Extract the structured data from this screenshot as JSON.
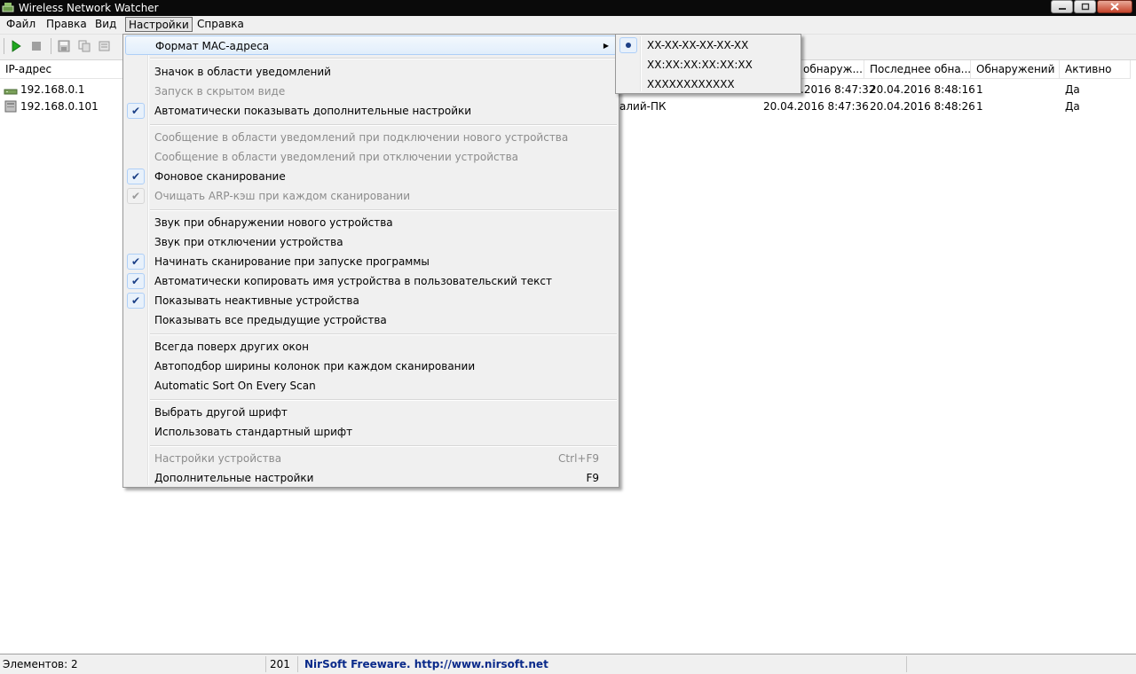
{
  "window": {
    "title": "Wireless Network Watcher"
  },
  "menubar": {
    "items": [
      "Файл",
      "Правка",
      "Вид",
      "Настройки",
      "Справка"
    ],
    "active": "Настройки"
  },
  "columns": [
    "IP-адрес",
    "обнаруж...",
    "Последнее обна...",
    "Обнаружений",
    "Активно"
  ],
  "rows": [
    {
      "ip": "192.168.0.1",
      "name": "",
      "first_seen": ".2016 8:47:32",
      "last_seen": "20.04.2016 8:48:16",
      "count": "1",
      "active": "Да"
    },
    {
      "ip": "192.168.0.101",
      "name": "алий-ПК",
      "first_seen": "20.04.2016 8:47:36",
      "last_seen": "20.04.2016 8:48:26",
      "count": "1",
      "active": "Да"
    }
  ],
  "settings_menu": {
    "items": [
      {
        "label": "Формат MAC-адреса",
        "submenu": true
      },
      {
        "label": "Значок в области уведомлений"
      },
      {
        "label": "Запуск в скрытом виде",
        "disabled": true
      },
      {
        "label": "Автоматически показывать дополнительные настройки",
        "checked": true
      },
      {
        "label": "Сообщение в области уведомлений при подключении нового устройства",
        "disabled": true
      },
      {
        "label": "Сообщение в области уведомлений при отключении устройства",
        "disabled": true
      },
      {
        "label": "Фоновое сканирование",
        "checked": true
      },
      {
        "label": "Очищать ARP-кэш при каждом сканировании",
        "checked": true,
        "disabled": true
      },
      {
        "label": "Звук при обнаружении нового устройства"
      },
      {
        "label": "Звук при отключении устройства"
      },
      {
        "label": "Начинать сканирование при запуске программы",
        "checked": true
      },
      {
        "label": "Автоматически копировать имя устройства в пользовательский текст",
        "checked": true
      },
      {
        "label": "Показывать неактивные устройства",
        "checked": true
      },
      {
        "label": "Показывать все предыдущие устройства"
      },
      {
        "label": "Всегда поверх других окон"
      },
      {
        "label": "Автоподбор ширины колонок при каждом сканировании"
      },
      {
        "label": "Automatic Sort On Every Scan"
      },
      {
        "label": "Выбрать другой шрифт"
      },
      {
        "label": "Использовать стандартный шрифт"
      },
      {
        "label": "Настройки устройства",
        "shortcut": "Ctrl+F9",
        "disabled": true
      },
      {
        "label": "Дополнительные настройки",
        "shortcut": "F9"
      }
    ]
  },
  "mac_format_submenu": {
    "items": [
      "XX-XX-XX-XX-XX-XX",
      "XX:XX:XX:XX:XX:XX",
      "XXXXXXXXXXXX"
    ],
    "selected": "XX-XX-XX-XX-XX-XX"
  },
  "statusbar": {
    "items_count": "Элементов: 2",
    "number": "201",
    "credit": "NirSoft Freeware.  http://www.nirsoft.net"
  },
  "icons": [
    "network-watcher-app-icon",
    "minimize-icon",
    "maximize-icon",
    "close-icon",
    "play-icon",
    "stop-icon",
    "save-icon",
    "copy-icon",
    "properties-icon",
    "router-icon",
    "computer-icon",
    "submenu-arrow-icon",
    "check-icon",
    "radio-dot-icon"
  ],
  "colors": {
    "titlebar": "#0a0a0a",
    "chrome": "#f0f0f0",
    "check": "#1b3f86",
    "play": "#1fa81f",
    "credit": "#0a2a8a"
  }
}
